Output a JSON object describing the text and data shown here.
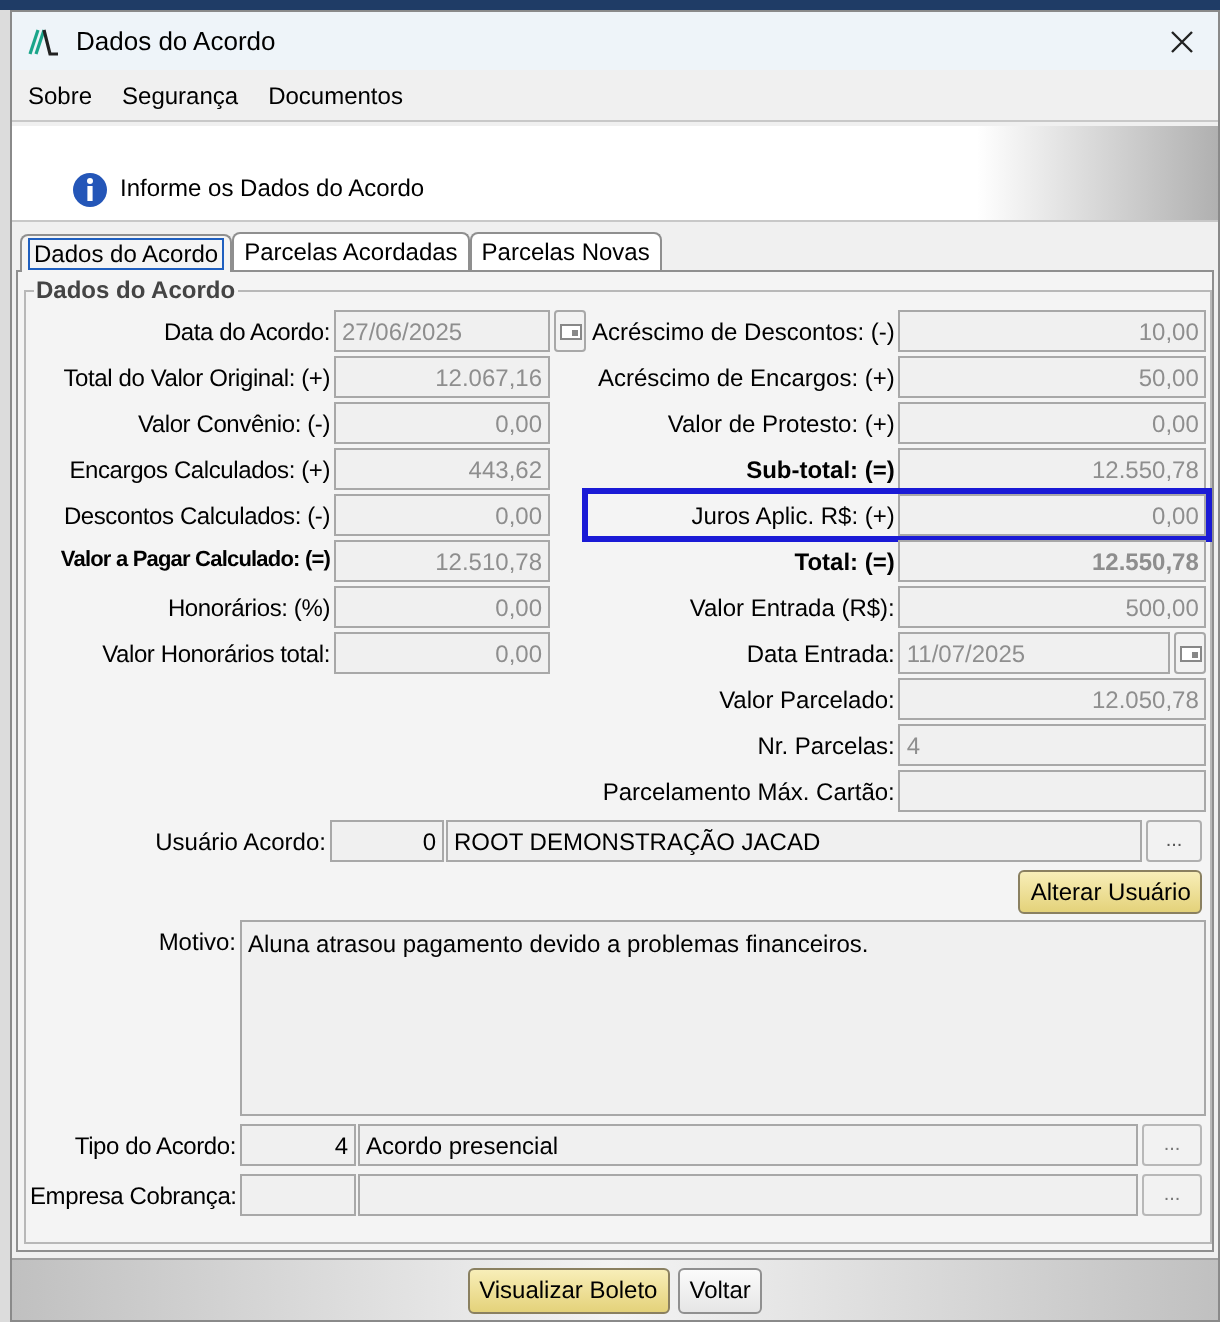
{
  "window": {
    "title": "Dados do Acordo"
  },
  "menu": [
    {
      "label": "Sobre"
    },
    {
      "label": "Segurança"
    },
    {
      "label": "Documentos"
    }
  ],
  "header": {
    "message": "Informe os Dados do Acordo"
  },
  "tabs": [
    {
      "label": "Dados do Acordo",
      "selected": true
    },
    {
      "label": "Parcelas Acordadas",
      "selected": false
    },
    {
      "label": "Parcelas Novas",
      "selected": false
    }
  ],
  "group": {
    "title": "Dados do Acordo",
    "left_fields": [
      {
        "label": "Data do Acordo:",
        "value": "27/06/2025",
        "kind": "date",
        "bold": false
      },
      {
        "label": "Total do Valor Original: (+)",
        "value": "12.067,16",
        "kind": "number",
        "bold": false
      },
      {
        "label": "Valor Convênio: (-)",
        "value": "0,00",
        "kind": "number",
        "bold": false
      },
      {
        "label": "Encargos Calculados: (+)",
        "value": "443,62",
        "kind": "number",
        "bold": false
      },
      {
        "label": "Descontos Calculados: (-)",
        "value": "0,00",
        "kind": "number",
        "bold": false
      },
      {
        "label": "Valor a Pagar Calculado: (=)",
        "value": "12.510,78",
        "kind": "number",
        "bold": true
      },
      {
        "label": "Honorários: (%)",
        "value": "0,00",
        "kind": "number",
        "bold": false
      },
      {
        "label": "Valor Honorários total:",
        "value": "0,00",
        "kind": "number",
        "bold": false
      }
    ],
    "right_fields": [
      {
        "label": "Acréscimo de Descontos: (-)",
        "value": "10,00",
        "kind": "number",
        "bold": false,
        "highlighted": false
      },
      {
        "label": "Acréscimo de Encargos: (+)",
        "value": "50,00",
        "kind": "number",
        "bold": false,
        "highlighted": false
      },
      {
        "label": "Valor de Protesto: (+)",
        "value": "0,00",
        "kind": "number",
        "bold": false,
        "highlighted": false
      },
      {
        "label": "Sub-total: (=)",
        "value": "12.550,78",
        "kind": "number",
        "bold": true,
        "highlighted": false
      },
      {
        "label": "Juros Aplic. R$: (+)",
        "value": "0,00",
        "kind": "number",
        "bold": false,
        "highlighted": true
      },
      {
        "label": "Total: (=)",
        "value": "12.550,78",
        "kind": "number",
        "bold": true,
        "value_bold": true,
        "highlighted": false
      },
      {
        "label": "Valor Entrada (R$):",
        "value": "500,00",
        "kind": "number",
        "bold": false,
        "highlighted": false
      },
      {
        "label": "Data Entrada:",
        "value": "11/07/2025",
        "kind": "date",
        "bold": false,
        "highlighted": false
      },
      {
        "label": "Valor Parcelado:",
        "value": "12.050,78",
        "kind": "number",
        "bold": false,
        "highlighted": false
      },
      {
        "label": "Nr. Parcelas:",
        "value": "4",
        "kind": "text",
        "bold": false,
        "highlighted": false
      },
      {
        "label": "Parcelamento Máx. Cartão:",
        "kind": "text",
        "bold": false,
        "highlighted": false
      }
    ],
    "user": {
      "label": "Usuário Acordo:",
      "code": "0",
      "name": "ROOT DEMONSTRAÇÃO JACAD",
      "lookup": "...",
      "change_button": "Alterar Usuário"
    },
    "reason": {
      "label": "Motivo:",
      "value": "Aluna atrasou pagamento devido a problemas financeiros."
    },
    "lookups": [
      {
        "label": "Tipo do Acordo:",
        "code": "4",
        "name": "Acordo presencial",
        "lookup": "..."
      },
      {
        "label": "Empresa Cobrança:",
        "lookup": "..."
      }
    ]
  },
  "buttons": [
    {
      "label": "Visualizar Boleto",
      "primary": true
    },
    {
      "label": "Voltar",
      "primary": false
    }
  ]
}
